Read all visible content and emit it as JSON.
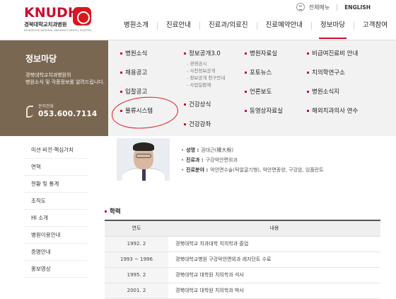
{
  "logo": {
    "brand": "KNUDH",
    "name": "경북대학교치과병원",
    "tagline": "KYUNGPOOK NATIONAL UNIVERSITY DENTAL HOSPITAL"
  },
  "utility": {
    "menu_label": "전체메뉴",
    "language": "ENGLISH"
  },
  "gnb": [
    {
      "label": "병원소개"
    },
    {
      "label": "진료안내"
    },
    {
      "label": "진료과/의료진"
    },
    {
      "label": "진료예약안내"
    },
    {
      "label": "정보마당",
      "active": true
    },
    {
      "label": "고객참여"
    }
  ],
  "mega": {
    "title": "정보마당",
    "description_line1": "경북대학교치과병원의",
    "description_line2": "병원소식 및 각종정보를 알려드립니다.",
    "contact_label": "문의전화",
    "contact_number": "053.600.7114",
    "col1": [
      "병원소식",
      "채용공고",
      "입찰공고",
      "물류시스템"
    ],
    "col2_main": "정보공개3.0",
    "col2_sub": [
      "경영공시",
      "사전정보공개",
      "정보공개 청구안내",
      "사업일람제"
    ],
    "col2_more": [
      "건강상식",
      "건강강좌"
    ],
    "col3": [
      "병원자료실",
      "포토뉴스",
      "언론보도",
      "동영상자료실"
    ],
    "col4": [
      "비급여진료비 안내",
      "치의학연구소",
      "병원소식지",
      "해외치과의사 연수"
    ]
  },
  "lnb": [
    "미션·비전·핵심가치",
    "연혁",
    "현황 및 통계",
    "조직도",
    "HI 소개",
    "병원이용안내",
    "증명안내",
    "홍보영상"
  ],
  "profile": {
    "name_label": "성명 :",
    "name_value": "권대근(權大根)",
    "dept_label": "진료과 :",
    "dept_value": "구강악안면외과",
    "field_label": "진료분야 :",
    "field_value": "악안면수술(턱얼굴기형), 악안면종양, 구강암, 임플란트"
  },
  "history": {
    "title": "학력",
    "col_year": "연도",
    "col_content": "내용",
    "rows": [
      {
        "year": "1992. 2",
        "desc": "경북대학교 치과대학 치의학과 졸업"
      },
      {
        "year": "1993 ~ 1996",
        "desc": "경북대학교병원 구강악안면외과 레지던트 수료"
      },
      {
        "year": "1995. 2",
        "desc": "경북대학교 대학원 치의학과 석사"
      },
      {
        "year": "2001. 2",
        "desc": "경북대학교 대학원 치의학과 박사"
      }
    ]
  },
  "colors": {
    "brand_red": "#c8102e",
    "menu_brown": "#7a6751",
    "annotation_red": "#e0141e"
  }
}
